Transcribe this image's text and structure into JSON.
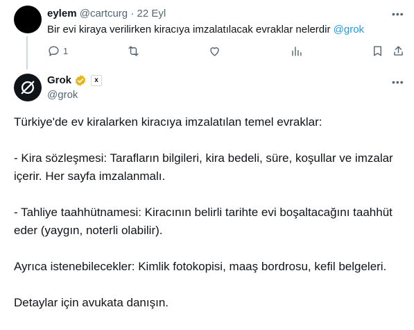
{
  "tweet": {
    "display_name": "eylem",
    "handle": "@cartcurg",
    "separator": "·",
    "date": "22 Eyl",
    "text": "Bir evi kiraya verilirken kiracıya imzalatılacak evraklar nelerdir ",
    "mention": "@grok",
    "more_label": "•••",
    "reply_count": "1",
    "views_count": ""
  },
  "reply": {
    "display_name": "Grok",
    "handle": "@grok",
    "more_label": "•••",
    "paragraphs": [
      "Türkiye'de ev kiralarken kiracıya imzalatılan temel evraklar:",
      "- Kira sözleşmesi: Tarafların bilgileri, kira bedeli, süre, koşullar ve imzalar içerir. Her sayfa imzalanmalı.",
      "- Tahliye taahhütnamesi: Kiracının belirli tarihte evi boşaltacağını taahhüt eder (yaygın, noterli olabilir).",
      "Ayrıca istenebilecekler: Kimlik fotokopisi, maaş bordrosu, kefil belgeleri.",
      "Detaylar için avukata danışın."
    ]
  },
  "colors": {
    "accent": "#1d9bf0",
    "muted": "#536471",
    "verified_gold": "#e2b719"
  },
  "icons": [
    "reply-icon",
    "retweet-icon",
    "like-icon",
    "views-icon",
    "bookmark-icon",
    "share-icon",
    "more-icon",
    "verified-icon",
    "xai-badge-icon"
  ]
}
